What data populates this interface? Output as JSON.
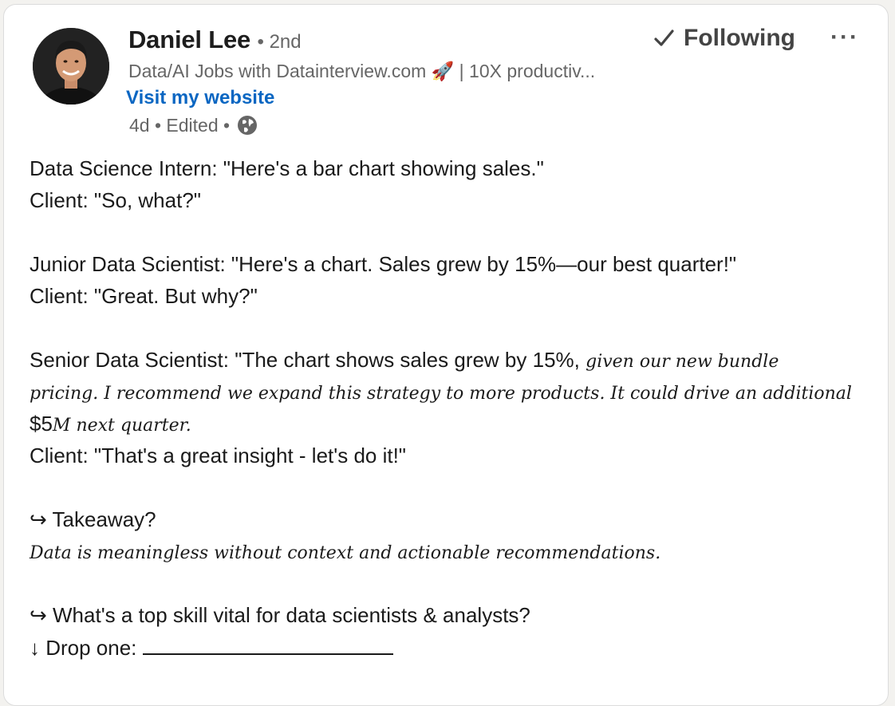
{
  "author": {
    "name": "Daniel Lee",
    "degree": "• 2nd",
    "headline": "Data/AI Jobs with Datainterview.com 🚀 | 10X productiv...",
    "website_label": "Visit my website",
    "meta": "4d • Edited •",
    "avatar_icon": "profile-photo",
    "visibility_icon": "globe-icon"
  },
  "actions": {
    "follow_label": "Following",
    "more_label": "···"
  },
  "post": {
    "l1": "Data Science Intern: \"Here's a bar chart showing sales.\"",
    "l2": "Client: \"So, what?\"",
    "l3": "Junior Data Scientist: \"Here's a chart. Sales grew by 15%—our best quarter!\"",
    "l4": "Client: \"Great. But why?\"",
    "l5a": "Senior Data Scientist: \"The chart shows sales grew by 15%, ",
    "l5b": "given our new bundle",
    "l6": "pricing. I recommend we expand this strategy to more products. It could drive an additional",
    "l7a": "$5",
    "l7b": "M next quarter.",
    "l8": "Client: \"That's a great insight - let's do it!\"",
    "l9": "↪ Takeaway?",
    "l10": "Data is meaningless without context and actionable recommendations.",
    "l11": "↪ What's a top skill vital for data scientists & analysts?",
    "l12": "↓ Drop one: "
  },
  "colors": {
    "link": "#0a66c2",
    "muted": "#666666",
    "text": "#1a1a1a"
  }
}
